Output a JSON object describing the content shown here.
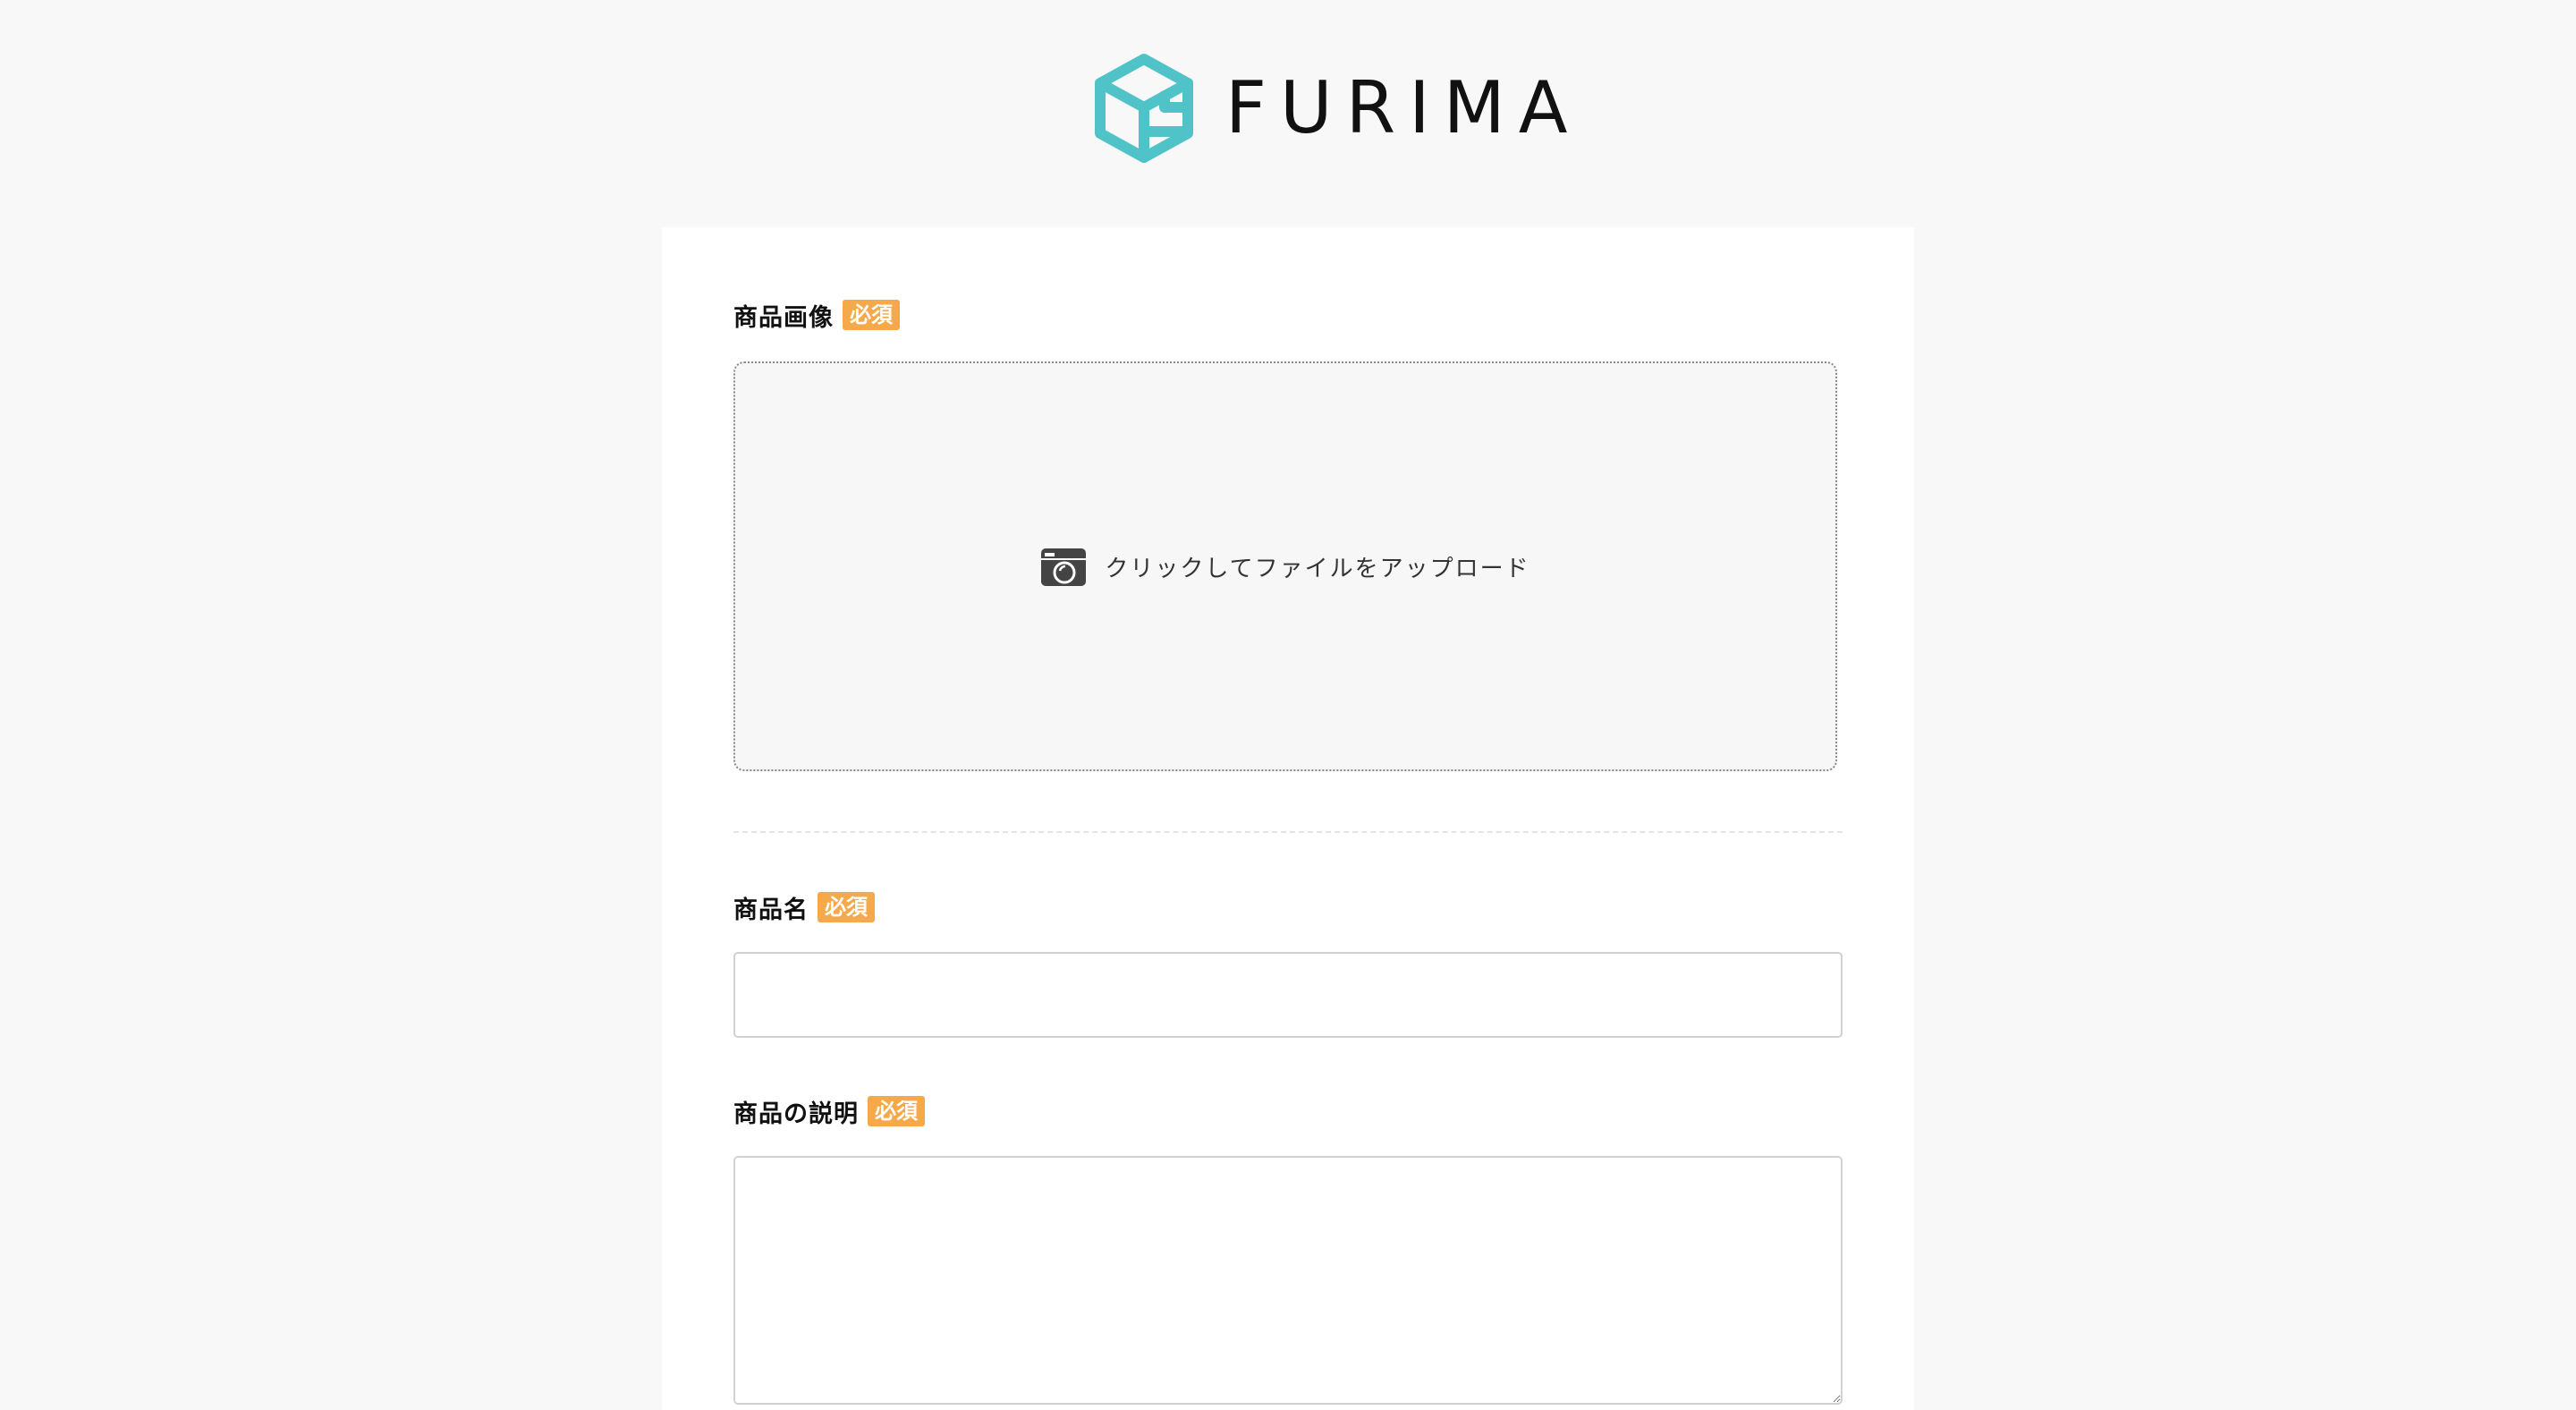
{
  "header": {
    "logo_text": "FURIMA",
    "logo_icon": "box-logo-icon",
    "logo_color": "#4fc3c8"
  },
  "form": {
    "required_label": "必須",
    "required_color": "#f5a94b",
    "image_field": {
      "label": "商品画像",
      "upload_icon": "camera-icon",
      "upload_text": "クリックしてファイルをアップロード"
    },
    "name_field": {
      "label": "商品名",
      "value": "",
      "placeholder": ""
    },
    "description_field": {
      "label": "商品の説明",
      "value": "",
      "placeholder": ""
    }
  }
}
